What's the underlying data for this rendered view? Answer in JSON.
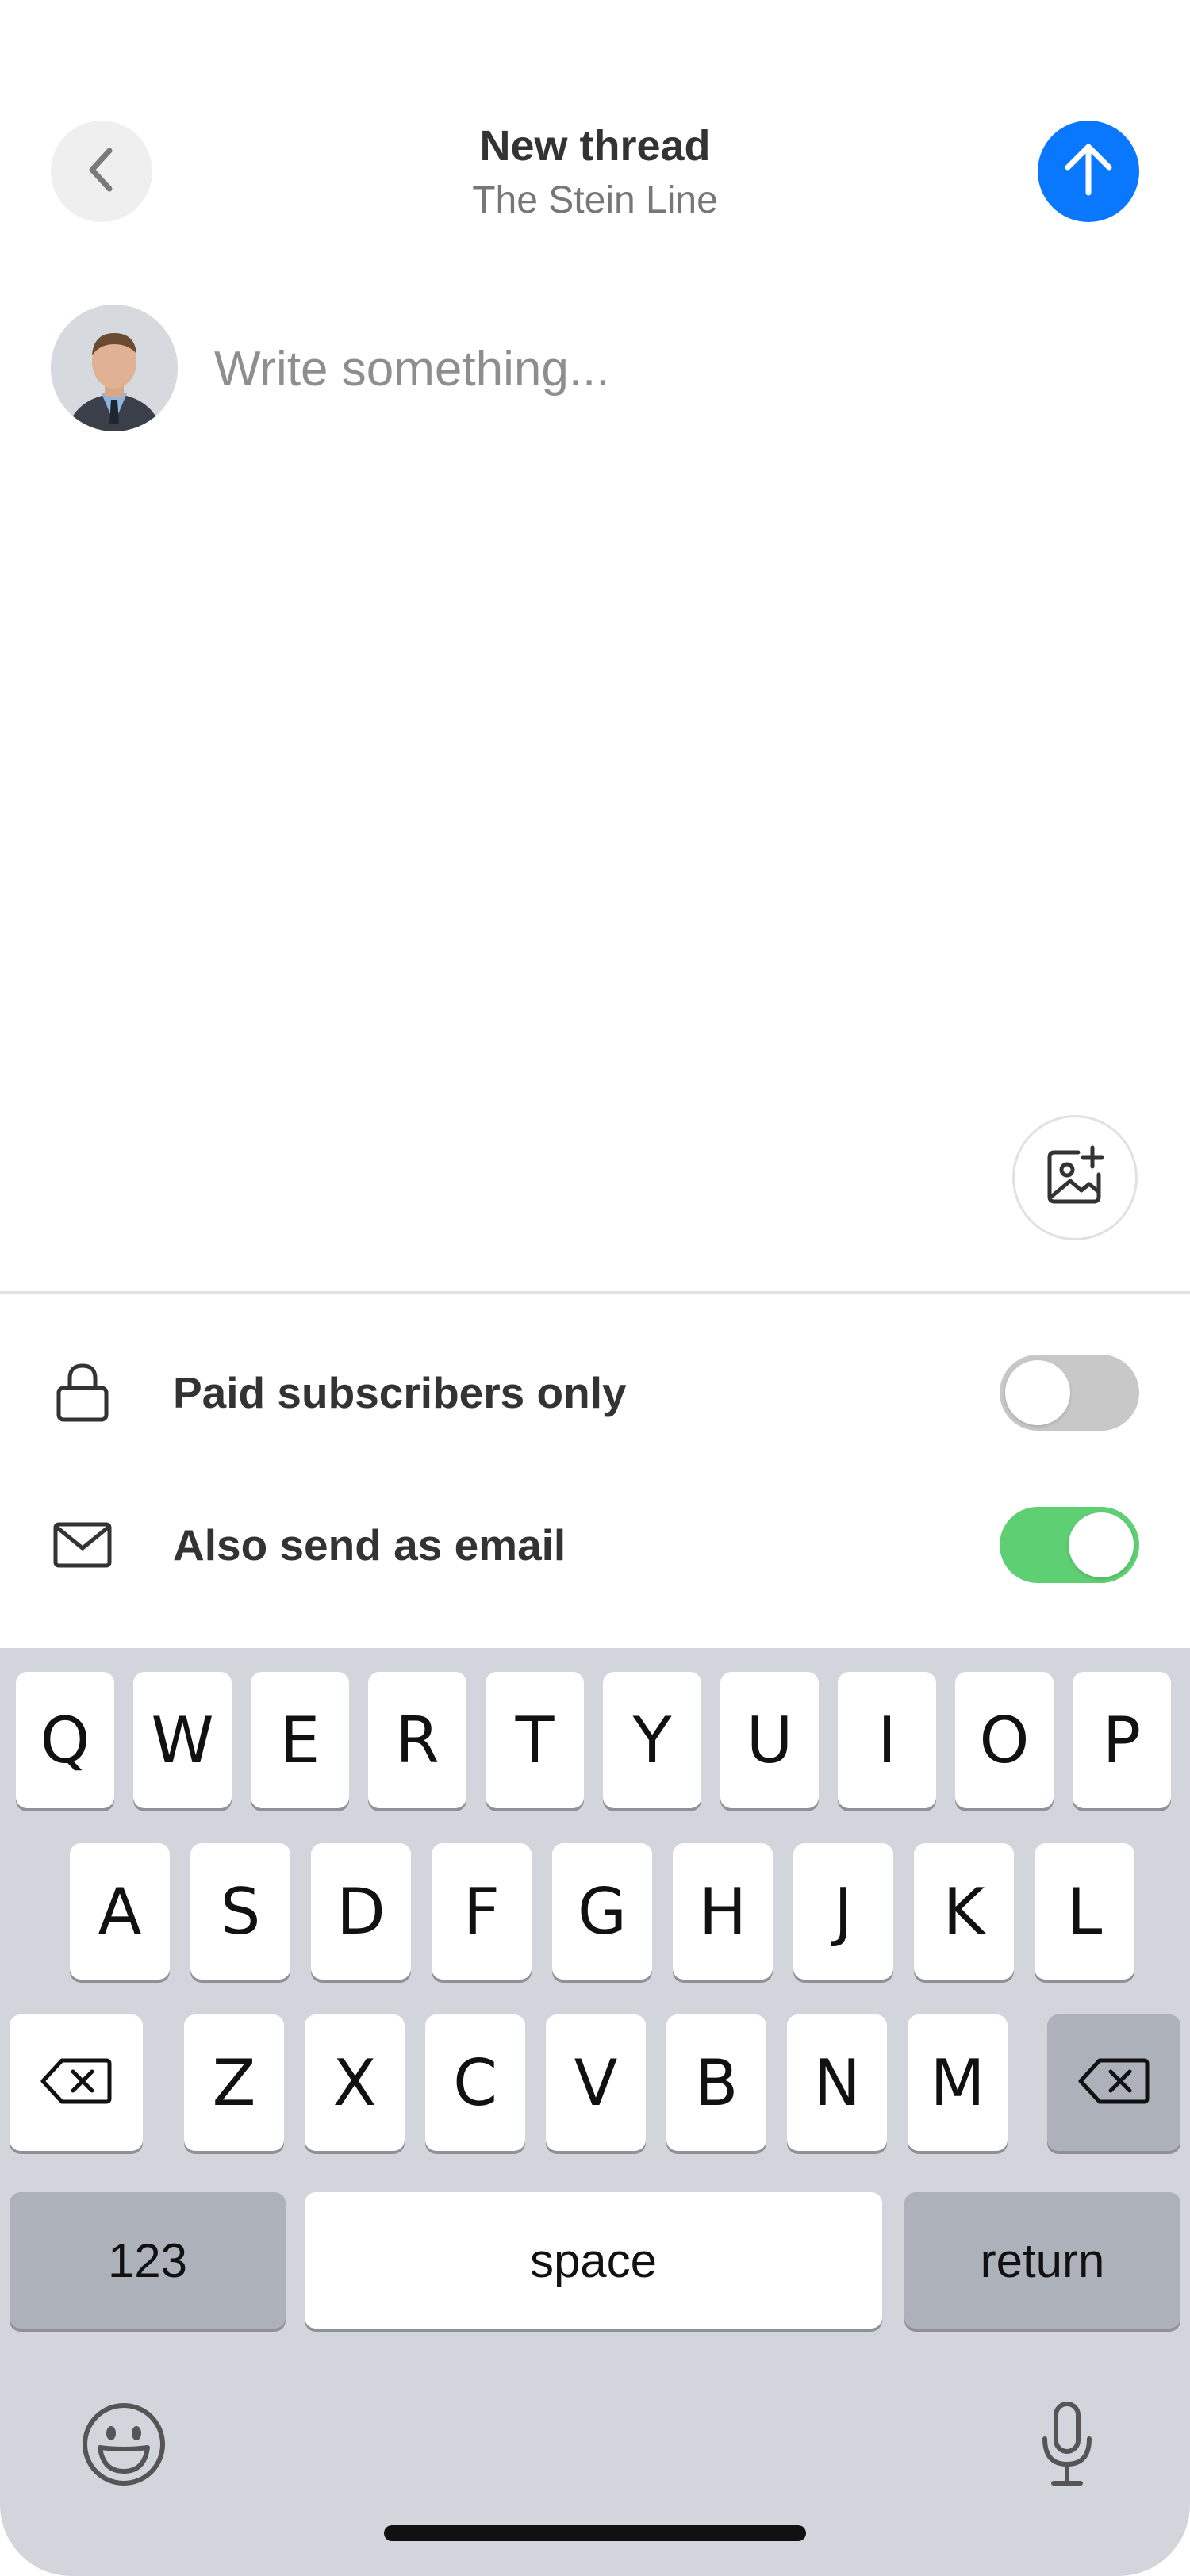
{
  "header": {
    "title": "New thread",
    "subtitle": "The Stein Line",
    "back_icon": "chevron-left-icon",
    "send_icon": "arrow-up-icon",
    "accent_color": "#0a77ff"
  },
  "compose": {
    "placeholder": "Write something...",
    "value": ""
  },
  "options": [
    {
      "label": "Paid subscribers only",
      "icon": "lock-icon",
      "enabled": false
    },
    {
      "label": "Also send as email",
      "icon": "mail-icon",
      "enabled": true
    }
  ],
  "keyboard": {
    "row1": [
      "Q",
      "W",
      "E",
      "R",
      "T",
      "Y",
      "U",
      "I",
      "O",
      "P"
    ],
    "row2": [
      "A",
      "S",
      "D",
      "F",
      "G",
      "H",
      "J",
      "K",
      "L"
    ],
    "row3": [
      "Z",
      "X",
      "C",
      "V",
      "B",
      "N",
      "M"
    ],
    "numbers_label": "123",
    "space_label": "space",
    "return_label": "return",
    "emoji_icon": "emoji-icon",
    "mic_icon": "microphone-icon",
    "backspace_icon": "backspace-icon"
  },
  "colors": {
    "toggle_on": "#5ecf72",
    "toggle_off": "#c8c8c8",
    "keyboard_bg": "#d2d5dc"
  }
}
